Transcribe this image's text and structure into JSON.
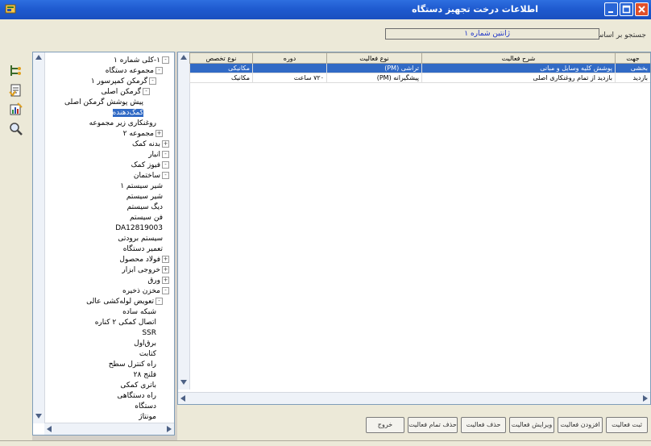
{
  "window": {
    "title": "اطلاعات درخت تجهیز دستگاه",
    "colors": {
      "titlebar": "#1f5bd0",
      "selection": "#316ac5",
      "close": "#e0502a"
    }
  },
  "header": {
    "code_label": "جستجو بر اساس:",
    "code_value": "ژانتین شماره ۱"
  },
  "toolbar": {
    "icons": [
      "tree-icon",
      "document-icon",
      "chart-icon",
      "magnifier-icon"
    ]
  },
  "tree": {
    "items": [
      {
        "label": "۱-کلی شماره ۱",
        "expander": "-"
      },
      {
        "label": "مجموعه دستگاه",
        "expander": "-"
      },
      {
        "label": "گرمکن کمپرسور ۱",
        "expander": "-"
      },
      {
        "label": "گرمکن اصلی",
        "expander": "-"
      },
      {
        "label": "پیش پوشش گرمکن اصلی",
        "expander": ""
      },
      {
        "label": "کمک‌دهنده",
        "expander": "",
        "selected": true
      },
      {
        "label": "روغنکاری زیر مجموعه",
        "expander": ""
      },
      {
        "label": "مجموعه ۲",
        "expander": "+"
      },
      {
        "label": "بدنه کمک",
        "expander": "+"
      },
      {
        "label": "انبار",
        "expander": "-"
      },
      {
        "label": "فیوز کمک",
        "expander": "-"
      },
      {
        "label": "ساختمان",
        "expander": "-"
      },
      {
        "label": "شیر سیستم ۱",
        "expander": ""
      },
      {
        "label": "شیر سیستم",
        "expander": ""
      },
      {
        "label": "دیگ سیستم",
        "expander": ""
      },
      {
        "label": "فن سیستم",
        "expander": ""
      },
      {
        "label": "DA12819003",
        "expander": ""
      },
      {
        "label": "سیستم برودتی",
        "expander": ""
      },
      {
        "label": "تعمیر دستگاه",
        "expander": ""
      },
      {
        "label": "فولاد محصول",
        "expander": "+"
      },
      {
        "label": "خروجی ابزار",
        "expander": "+"
      },
      {
        "label": "ورق",
        "expander": "+"
      },
      {
        "label": "مخزن ذخیره",
        "expander": "-"
      },
      {
        "label": "تعویض لوله‌کشی عالی",
        "expander": "-"
      },
      {
        "label": "شبکه ساده",
        "expander": ""
      },
      {
        "label": "اتصال کمکی ۲ کناره",
        "expander": ""
      },
      {
        "label": "SSR",
        "expander": ""
      },
      {
        "label": "برق‌اول",
        "expander": ""
      },
      {
        "label": "کتابت",
        "expander": ""
      },
      {
        "label": "راه کنترل سطح",
        "expander": ""
      },
      {
        "label": "فلنج ۲۸",
        "expander": ""
      },
      {
        "label": "باتری کمکی",
        "expander": ""
      },
      {
        "label": "راه دستگاهی",
        "expander": ""
      },
      {
        "label": "دستگاه",
        "expander": ""
      },
      {
        "label": "مونتاژ",
        "expander": ""
      }
    ]
  },
  "grid": {
    "columns": [
      "جهت",
      "شرح فعالیت",
      "نوع فعالیت",
      "دوره",
      "نوع تخصص"
    ],
    "rows": [
      [
        "بخشی",
        "پوشش کلیه وسایل و مبانی",
        "تراشی (PM)",
        "",
        "مکانیکی"
      ],
      [
        "بازدید",
        "بازدید از تمام روغنکاری اصلی",
        "پیشگیرانه (PM)",
        "۷۲۰ ساعت",
        "مکانیک"
      ]
    ]
  },
  "actions": {
    "buttons": [
      "ثبت فعالیت",
      "افزودن فعالیت",
      "ویرایش فعالیت",
      "حذف فعالیت",
      "حذف تمام فعالیت",
      "خروج"
    ]
  }
}
